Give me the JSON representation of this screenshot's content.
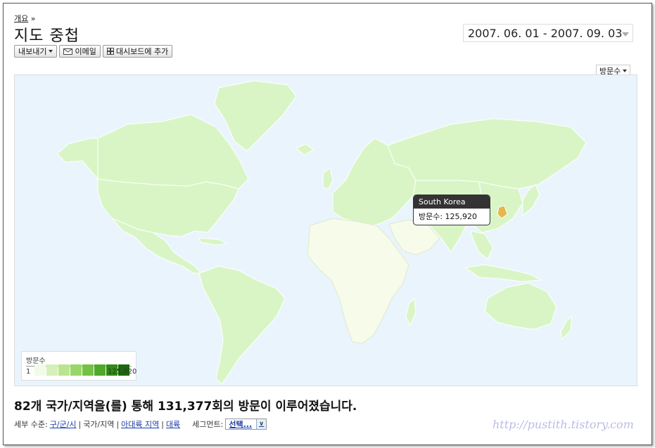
{
  "breadcrumb": {
    "link": "개요",
    "sep": "»"
  },
  "page_title": "지도 중첩",
  "date_range": "2007. 06. 01 - 2007. 09. 03",
  "toolbar": {
    "export_label": "내보내기",
    "email_label": "이메일",
    "dashboard_label": "대시보드에 추가"
  },
  "metric_select": "방문수",
  "tooltip": {
    "country": "South Korea",
    "label": "방문수: 125,920"
  },
  "legend": {
    "title": "방문수",
    "min": "1",
    "max": "125,920",
    "colors": [
      "#f2fbe6",
      "#d6f0b9",
      "#b9e58e",
      "#98d667",
      "#74c244",
      "#50a82a",
      "#2f8a16",
      "#1a6a0a"
    ]
  },
  "summary": {
    "count": "82",
    "part1": "개 국가/지역을(를) 통해 ",
    "visits": "131,377",
    "part2": "회의 방문이 이루어졌습니다."
  },
  "detail": {
    "label": "세부 수준:",
    "city": "구/군/시",
    "country": "국가/지역",
    "subcontinent": "아대륙 지역",
    "continent": "대륙",
    "segment_label": "세그먼트:",
    "segment_value": "선택..."
  },
  "watermark": "http://pustith.tistory.com",
  "colors": {
    "ocean": "#eaf4fc",
    "land_light": "#d9f5c6",
    "land_pale": "#f6fbea",
    "highlight": "#e4b84a",
    "border": "#ffffff"
  }
}
